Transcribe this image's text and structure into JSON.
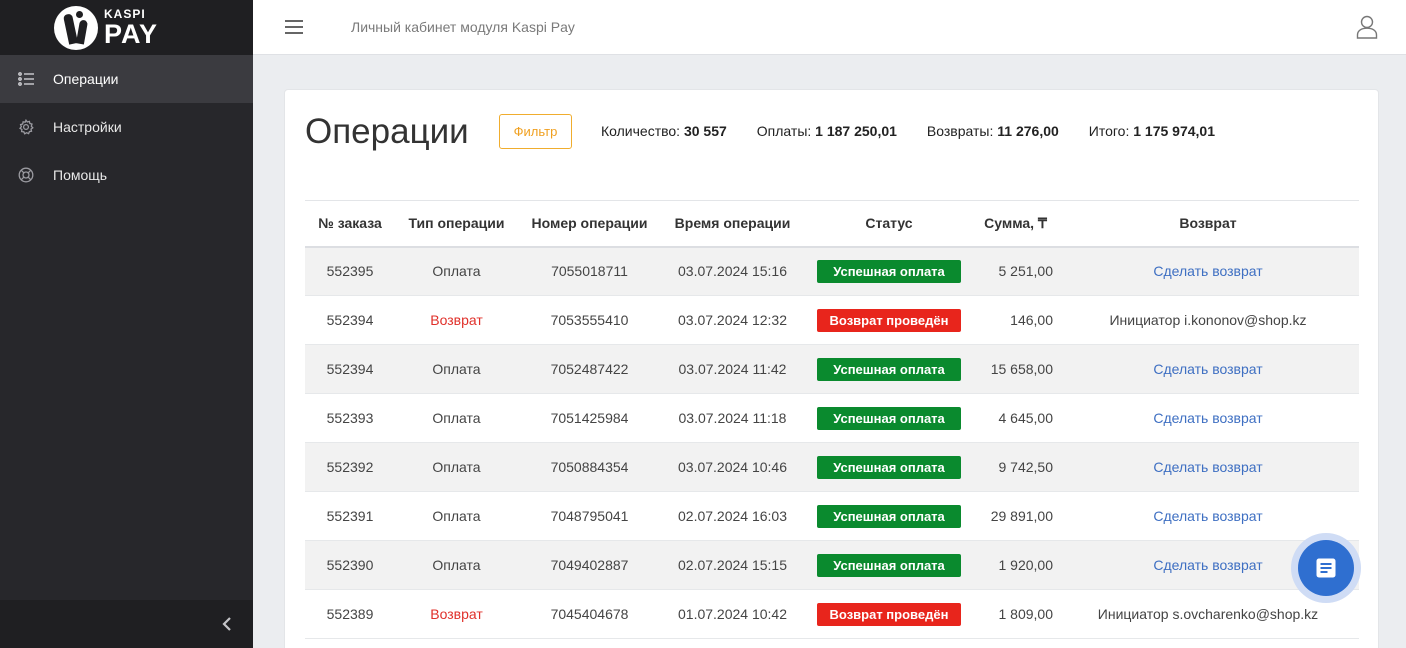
{
  "logo": {
    "top": "KASPI",
    "bottom": "PAY"
  },
  "sidebar": {
    "items": [
      {
        "label": "Операции",
        "icon": "list-icon",
        "active": true
      },
      {
        "label": "Настройки",
        "icon": "gear-icon",
        "active": false
      },
      {
        "label": "Помощь",
        "icon": "lifebuoy-icon",
        "active": false
      }
    ]
  },
  "header": {
    "title": "Личный кабинет модуля Kaspi Pay"
  },
  "page": {
    "title": "Операции",
    "filter_label": "Фильтр",
    "stats": [
      {
        "label": "Количество:",
        "value": "30 557"
      },
      {
        "label": "Оплаты:",
        "value": "1 187 250,01"
      },
      {
        "label": "Возвраты:",
        "value": "11 276,00"
      },
      {
        "label": "Итого:",
        "value": "1 175 974,01"
      }
    ]
  },
  "table": {
    "headers": [
      "№ заказа",
      "Тип операции",
      "Номер операции",
      "Время операции",
      "Статус",
      "Сумма, ₸",
      "Возврат"
    ],
    "rows": [
      {
        "order": "552395",
        "type": "Оплата",
        "op_no": "7055018711",
        "time": "03.07.2024 15:16",
        "status": "Успешная оплата",
        "sum": "5 251,00",
        "refund": "Сделать возврат"
      },
      {
        "order": "552394",
        "type": "Возврат",
        "op_no": "7053555410",
        "time": "03.07.2024 12:32",
        "status": "Возврат проведён",
        "sum": "146,00",
        "refund": "Инициатор i.kononov@shop.kz"
      },
      {
        "order": "552394",
        "type": "Оплата",
        "op_no": "7052487422",
        "time": "03.07.2024 11:42",
        "status": "Успешная оплата",
        "sum": "15 658,00",
        "refund": "Сделать возврат"
      },
      {
        "order": "552393",
        "type": "Оплата",
        "op_no": "7051425984",
        "time": "03.07.2024 11:18",
        "status": "Успешная оплата",
        "sum": "4 645,00",
        "refund": "Сделать возврат"
      },
      {
        "order": "552392",
        "type": "Оплата",
        "op_no": "7050884354",
        "time": "03.07.2024 10:46",
        "status": "Успешная оплата",
        "sum": "9 742,50",
        "refund": "Сделать возврат"
      },
      {
        "order": "552391",
        "type": "Оплата",
        "op_no": "7048795041",
        "time": "02.07.2024 16:03",
        "status": "Успешная оплата",
        "sum": "29 891,00",
        "refund": "Сделать возврат"
      },
      {
        "order": "552390",
        "type": "Оплата",
        "op_no": "7049402887",
        "time": "02.07.2024 15:15",
        "status": "Успешная оплата",
        "sum": "1 920,00",
        "refund": "Сделать возврат"
      },
      {
        "order": "552389",
        "type": "Возврат",
        "op_no": "7045404678",
        "time": "01.07.2024 10:42",
        "status": "Возврат проведён",
        "sum": "1 809,00",
        "refund": "Инициатор s.ovcharenko@shop.kz"
      }
    ]
  },
  "colors": {
    "success": "#0a8a2e",
    "refund": "#e8251c",
    "link": "#3e6fc2",
    "accent": "#f0ad2e"
  }
}
